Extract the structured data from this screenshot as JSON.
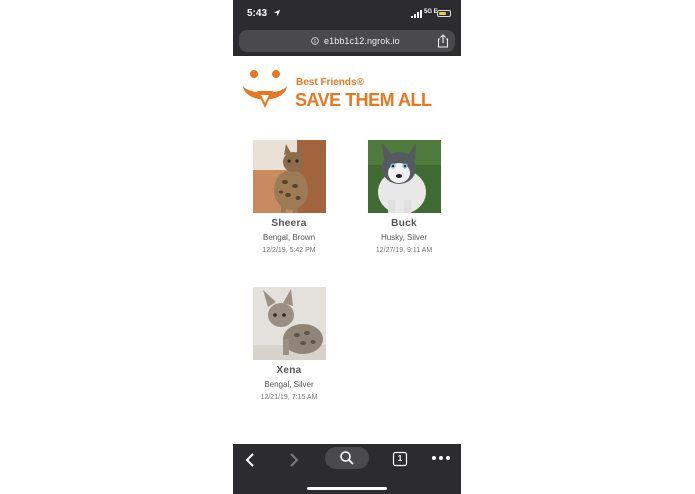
{
  "status_bar": {
    "time": "5:43",
    "network": "5G E",
    "icons": [
      "location-arrow-icon",
      "signal-icon",
      "battery-icon"
    ]
  },
  "browser": {
    "url": "e1bb1c12.ngrok.io",
    "icons": [
      "info-icon",
      "share-icon"
    ]
  },
  "logo": {
    "small_text": "Best Friends®",
    "big_text": "SAVE THEM ALL",
    "color": "#e87722"
  },
  "pets": [
    {
      "name": "Sheera",
      "breed": "Bengal, Brown",
      "date": "12/2/19, 5:42 PM"
    },
    {
      "name": "Buck",
      "breed": "Husky, Silver",
      "date": "12/27/19, 9:11 AM"
    },
    {
      "name": "Xena",
      "breed": "Bengal, Silver",
      "date": "12/21/19, 7:15 AM"
    }
  ],
  "toolbar": {
    "tab_count": "1",
    "icons": [
      "back-icon",
      "forward-icon",
      "search-icon",
      "tabs-icon",
      "more-icon"
    ]
  }
}
